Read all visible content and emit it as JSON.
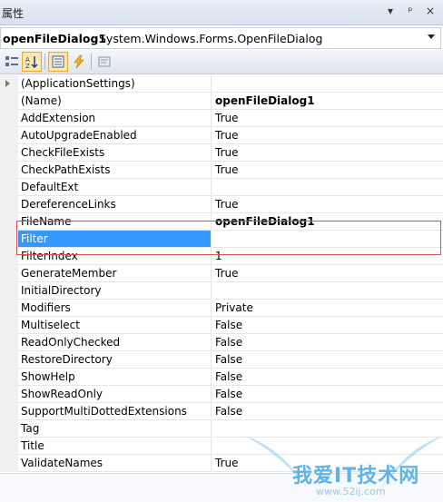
{
  "panel": {
    "title": "属性",
    "controls": [
      "▾",
      "ᵖ",
      "×"
    ]
  },
  "selector": {
    "object_name": "openFileDialog1",
    "object_type": "System.Windows.Forms.OpenFileDialog"
  },
  "toolbar": {
    "icons": [
      "categorized-icon",
      "alphabetical-icon",
      "properties-icon",
      "events-icon",
      "property-pages-icon"
    ]
  },
  "properties": [
    {
      "name": "(ApplicationSettings)",
      "value": "",
      "expandable": true
    },
    {
      "name": "(Name)",
      "value": "openFileDialog1",
      "bold": true
    },
    {
      "name": "AddExtension",
      "value": "True"
    },
    {
      "name": "AutoUpgradeEnabled",
      "value": "True"
    },
    {
      "name": "CheckFileExists",
      "value": "True"
    },
    {
      "name": "CheckPathExists",
      "value": "True"
    },
    {
      "name": "DefaultExt",
      "value": ""
    },
    {
      "name": "DereferenceLinks",
      "value": "True"
    },
    {
      "name": "FileName",
      "value": "openFileDialog1",
      "bold": true
    },
    {
      "name": "Filter",
      "value": "",
      "selected": true
    },
    {
      "name": "FilterIndex",
      "value": "1"
    },
    {
      "name": "GenerateMember",
      "value": "True"
    },
    {
      "name": "InitialDirectory",
      "value": ""
    },
    {
      "name": "Modifiers",
      "value": "Private"
    },
    {
      "name": "Multiselect",
      "value": "False"
    },
    {
      "name": "ReadOnlyChecked",
      "value": "False"
    },
    {
      "name": "RestoreDirectory",
      "value": "False"
    },
    {
      "name": "ShowHelp",
      "value": "False"
    },
    {
      "name": "ShowReadOnly",
      "value": "False"
    },
    {
      "name": "SupportMultiDottedExtensions",
      "value": "False"
    },
    {
      "name": "Tag",
      "value": ""
    },
    {
      "name": "Title",
      "value": ""
    },
    {
      "name": "ValidateNames",
      "value": "True"
    }
  ],
  "watermark": {
    "text": "我爱IT技术网",
    "url": "www.52ij.com"
  },
  "colors": {
    "selection": "#3399ff",
    "highlight_box": "#d9534f"
  }
}
